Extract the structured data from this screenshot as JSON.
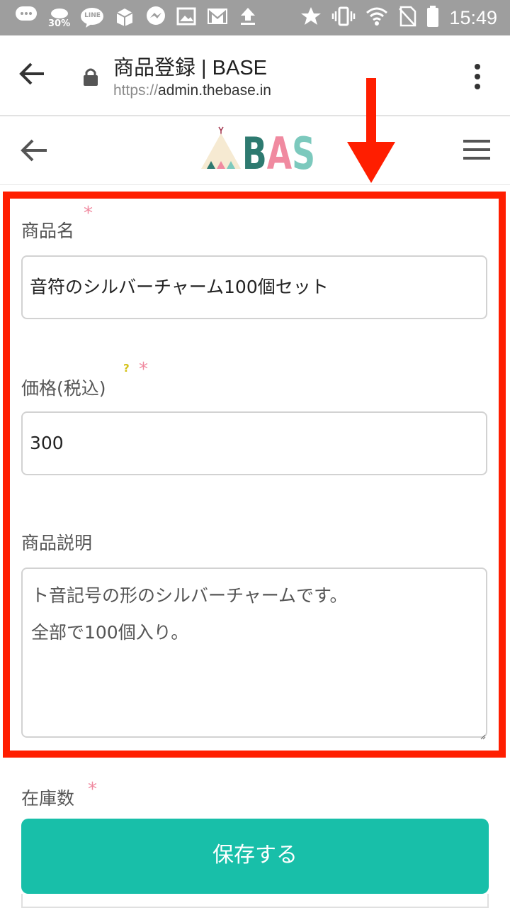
{
  "status_bar": {
    "battery_saver_pct": "30%",
    "line_label": "LINE",
    "time": "15:49"
  },
  "browser": {
    "page_title": "商品登録 | BASE",
    "url_scheme": "https://",
    "url_host": "admin.thebase.in"
  },
  "app_header": {
    "logo_text": "BASE",
    "logo_colors": [
      "#2e7a70",
      "#f08aa0",
      "#7cc9bd",
      "#a0304a"
    ]
  },
  "form": {
    "name_label": "商品名",
    "name_value": "音符のシルバーチャーム100個セット",
    "price_label": "価格(税込)",
    "price_value": "300",
    "description_label": "商品説明",
    "description_value": "ト音記号の形のシルバーチャームです。\n全部で100個入り。",
    "stock_label": "在庫数",
    "required_mark": "*",
    "help_mark": "?"
  },
  "save_button_label": "保存する",
  "colors": {
    "highlight": "#ff1e00",
    "save_button": "#18bfa9",
    "required": "#f08aa0",
    "help": "#d4c21a"
  }
}
